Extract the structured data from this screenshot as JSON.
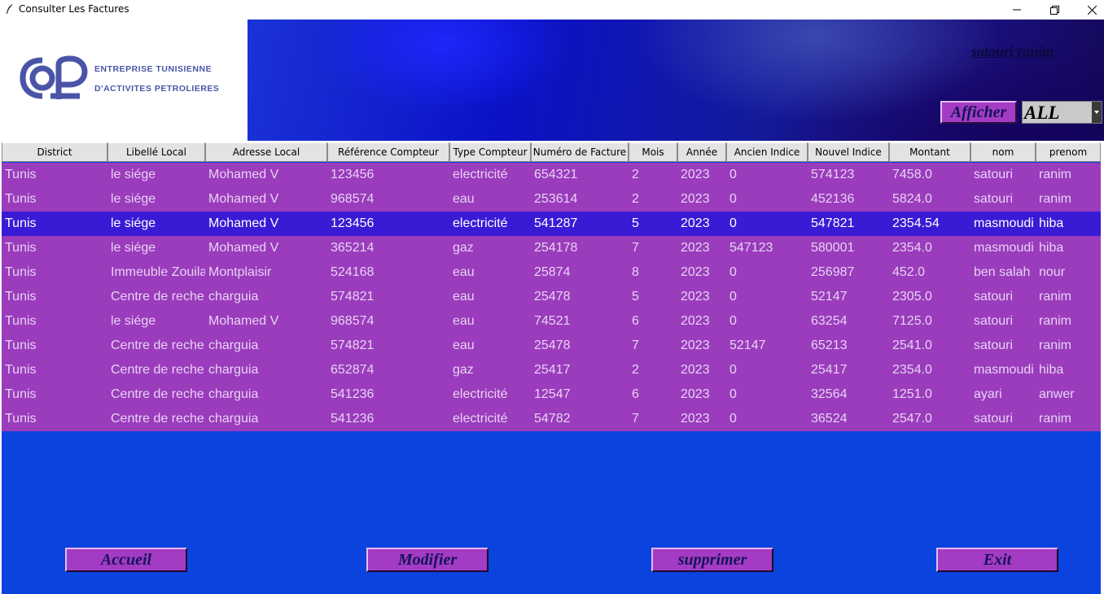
{
  "window": {
    "title": "Consulter Les Factures"
  },
  "logo": {
    "line1": "ENTREPRISE TUNISIENNE",
    "line2": "D'ACTIVITES PETROLIERES"
  },
  "header": {
    "username": "satouri ranim",
    "afficher_label": "Afficher",
    "filter_value": "ALL"
  },
  "colors": {
    "row": "#9a3cbc",
    "selected_row": "#3b1ad6",
    "panel": "#0b43de",
    "button": "#a43bc4"
  },
  "table": {
    "columns": [
      "District",
      "Libellé Local",
      "Adresse Local",
      "Référence Compteur",
      "Type Compteur",
      "Numéro de Facture",
      "Mois",
      "Année",
      "Ancien Indice",
      "Nouvel Indice",
      "Montant",
      "nom",
      "prenom"
    ],
    "selected_index": 2,
    "rows": [
      [
        "Tunis",
        "le siége",
        "Mohamed V",
        "123456",
        "electricité",
        "654321",
        "2",
        "2023",
        "0",
        "574123",
        "7458.0",
        "satouri",
        "ranim"
      ],
      [
        "Tunis",
        "le siége",
        "Mohamed V",
        "968574",
        "eau",
        "253614",
        "2",
        "2023",
        "0",
        "452136",
        "5824.0",
        "satouri",
        "ranim"
      ],
      [
        "Tunis",
        "le siége",
        "Mohamed V",
        "123456",
        "electricité",
        "541287",
        "5",
        "2023",
        "0",
        "547821",
        "2354.54",
        "masmoudi",
        "hiba"
      ],
      [
        "Tunis",
        "le siége",
        "Mohamed V",
        "365214",
        "gaz",
        "254178",
        "7",
        "2023",
        "547123",
        "580001",
        "2354.0",
        "masmoudi",
        "hiba"
      ],
      [
        "Tunis",
        "Immeuble Zouila",
        "Montplaisir",
        "524168",
        "eau",
        "25874",
        "8",
        "2023",
        "0",
        "256987",
        "452.0",
        "ben salah",
        "nour"
      ],
      [
        "Tunis",
        "Centre de reche",
        "charguia",
        "574821",
        "eau",
        "25478",
        "5",
        "2023",
        "0",
        "52147",
        "2305.0",
        "satouri",
        "ranim"
      ],
      [
        "Tunis",
        "le siége",
        "Mohamed V",
        "968574",
        "eau",
        "74521",
        "6",
        "2023",
        "0",
        "63254",
        "7125.0",
        "satouri",
        "ranim"
      ],
      [
        "Tunis",
        "Centre de reche",
        "charguia",
        "574821",
        "eau",
        "25478",
        "7",
        "2023",
        "52147",
        "65213",
        "2541.0",
        "satouri",
        "ranim"
      ],
      [
        "Tunis",
        "Centre de reche",
        "charguia",
        "652874",
        "gaz",
        "25417",
        "2",
        "2023",
        "0",
        "25417",
        "2354.0",
        "masmoudi",
        "hiba"
      ],
      [
        "Tunis",
        "Centre de reche",
        "charguia",
        "541236",
        "electricité",
        "12547",
        "6",
        "2023",
        "0",
        "32564",
        "1251.0",
        "ayari",
        "anwer"
      ],
      [
        "Tunis",
        "Centre de reche",
        "charguia",
        "541236",
        "electricité",
        "54782",
        "7",
        "2023",
        "0",
        "36524",
        "2547.0",
        "satouri",
        "ranim"
      ]
    ]
  },
  "actions": {
    "accueil": "Accueil",
    "modifier": "Modifier",
    "supprimer": "supprimer",
    "exit": "Exit"
  }
}
